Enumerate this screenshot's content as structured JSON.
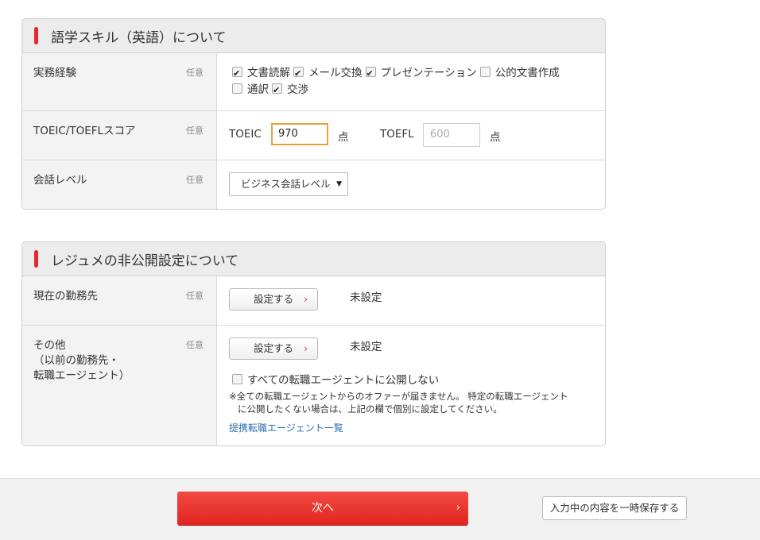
{
  "lang_section": {
    "title": "語学スキル（英語）について",
    "rows": {
      "work_experience": {
        "label": "実務経験",
        "optional": "任意",
        "checkboxes": [
          {
            "label": "文書読解",
            "checked": true
          },
          {
            "label": "メール交換",
            "checked": true
          },
          {
            "label": "プレゼンテーション",
            "checked": true
          },
          {
            "label": "公的文書作成",
            "checked": false
          },
          {
            "label": "通訳",
            "checked": false
          },
          {
            "label": "交渉",
            "checked": true
          }
        ]
      },
      "score": {
        "label": "TOEIC/TOEFLスコア",
        "optional": "任意",
        "toeic_label": "TOEIC",
        "toeic_value": "970",
        "toeic_unit": "点",
        "toefl_label": "TOEFL",
        "toefl_placeholder": "600",
        "toefl_unit": "点"
      },
      "conversation": {
        "label": "会話レベル",
        "optional": "任意",
        "selected": "ビジネス会話レベル",
        "caret": "▼"
      }
    }
  },
  "privacy_section": {
    "title": "レジュメの非公開設定について",
    "rows": {
      "current": {
        "label": "現在の勤務先",
        "optional": "任意",
        "button": "設定する",
        "chevron": "›",
        "status": "未設定"
      },
      "other": {
        "label_line1": "その他",
        "label_line2": "（以前の勤務先・",
        "label_line3": "転職エージェント）",
        "optional": "任意",
        "button": "設定する",
        "chevron": "›",
        "status": "未設定",
        "checkbox_label": "すべての転職エージェントに公開しない",
        "checkbox_checked": false,
        "note_line1": "※全ての転職エージェントからのオファーが届きません。 特定の転職エージェント",
        "note_line2": "に公開したくない場合は、上記の欄で個別に設定してください。",
        "link": "提携転職エージェント一覧"
      }
    }
  },
  "footer": {
    "next_label": "次へ",
    "next_chevron": "›",
    "save_label": "入力中の内容を一時保存する"
  }
}
